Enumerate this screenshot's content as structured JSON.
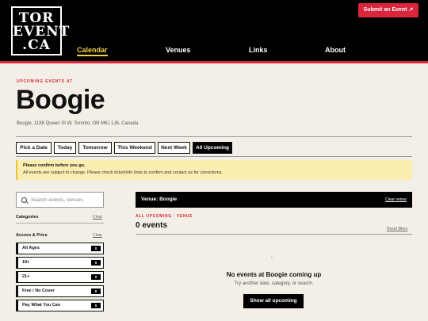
{
  "header": {
    "logo": {
      "line1": "TOR",
      "line2": "EVENT",
      "line3": ".CA"
    },
    "submit_label": "Submit an Event ↗",
    "nav": [
      "Calendar",
      "Venues",
      "Links",
      "About"
    ]
  },
  "page": {
    "eyebrow": "UPCOMING EVENTS AT",
    "title": "Boogie",
    "address": "Boogie, 1188 Queen St W, Toronto, ON M6J 1J6, Canada"
  },
  "date_filters": [
    "Pick a Date",
    "Today",
    "Tomorrow",
    "This Weekend",
    "Next Week",
    "All Upcoming"
  ],
  "notice": {
    "title": "Please confirm before you go.",
    "body": "All events are subject to change. Please check ticket/info links to confirm and contact us for corrections."
  },
  "sidebar": {
    "search_placeholder": "Search events, venues",
    "categories_label": "Categories",
    "clear_label": "Clear",
    "access_label": "Access & Price",
    "access_items": [
      {
        "label": "All Ages",
        "count": "0"
      },
      {
        "label": "19+",
        "count": "0"
      },
      {
        "label": "21+",
        "count": "0"
      },
      {
        "label": "Free / No Cover",
        "count": "0"
      },
      {
        "label": "Pay What You Can",
        "count": "0"
      }
    ]
  },
  "results": {
    "venue_bar": "Venue: Boogie",
    "clear_venue": "Clear venue",
    "eyebrow": "ALL UPCOMING · VENUE",
    "count": "0 events",
    "reset": "Reset filters",
    "empty_icon": "˘",
    "empty_title": "No events at Boogie coming up",
    "empty_sub": "Try another date, category, or search.",
    "show_all": "Show all upcoming"
  },
  "colors": {
    "accent_red": "#d9263a",
    "nav_active": "#f1d34a",
    "notice_bg": "#fbeeb0",
    "background": "#f3efe7"
  }
}
